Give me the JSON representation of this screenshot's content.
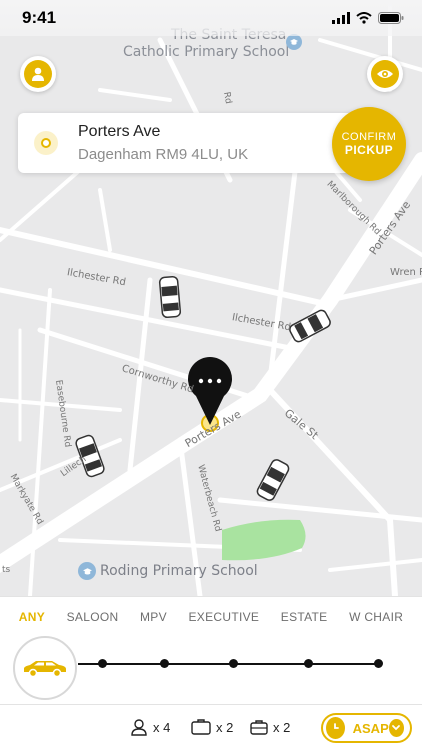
{
  "status": {
    "time": "9:41"
  },
  "map": {
    "pois": [
      "The Saint Teresa",
      "Catholic Primary School",
      "Roding Primary School"
    ],
    "streets": {
      "porters_ave_main": "Porters Ave",
      "porters_ave_ne": "Porters Ave",
      "ilchester_1": "Ilchester Rd",
      "ilchester_2": "Ilchester Rd",
      "cornworthy": "Cornworthy Rd",
      "marlborough": "Marlborough Rd",
      "wren": "Wren R",
      "gale": "Gale St",
      "waterbeach": "Waterbeach Rd",
      "easebourne": "Easebourne Rd",
      "markyate": "Markyate Rd",
      "lillech": "Lillech",
      "rd_top": "Rd",
      "ts": "ts"
    },
    "green_color": "#a9e3a0"
  },
  "address": {
    "street": "Porters Ave",
    "postcode": "Dagenham RM9 4LU, UK"
  },
  "confirm": {
    "line1": "CONFIRM",
    "line2": "PICKUP"
  },
  "vehicle_types": [
    "ANY",
    "SALOON",
    "MPV",
    "EXECUTIVE",
    "ESTATE",
    "W CHAIR"
  ],
  "active_vehicle": "ANY",
  "bottom": {
    "passengers": "x 4",
    "bags": "x 2",
    "hand_luggage": "x 2",
    "when": "ASAP"
  },
  "colors": {
    "accent": "#e5b600",
    "map_bg": "#e9e9ea",
    "road": "#ffffff"
  }
}
